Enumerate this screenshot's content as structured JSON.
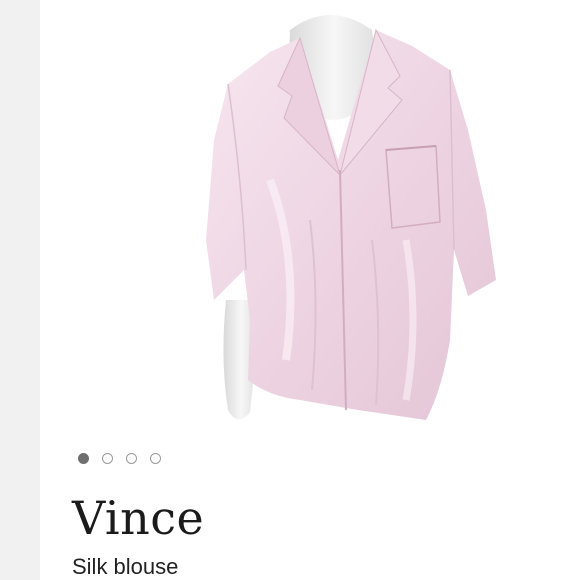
{
  "product": {
    "brand": "Vince",
    "subtitle": "Silk blouse",
    "image_icon": "silk-blouse-on-mannequin",
    "blouse_color": "#f0dbe8"
  },
  "carousel": {
    "total": 4,
    "active_index": 0
  }
}
